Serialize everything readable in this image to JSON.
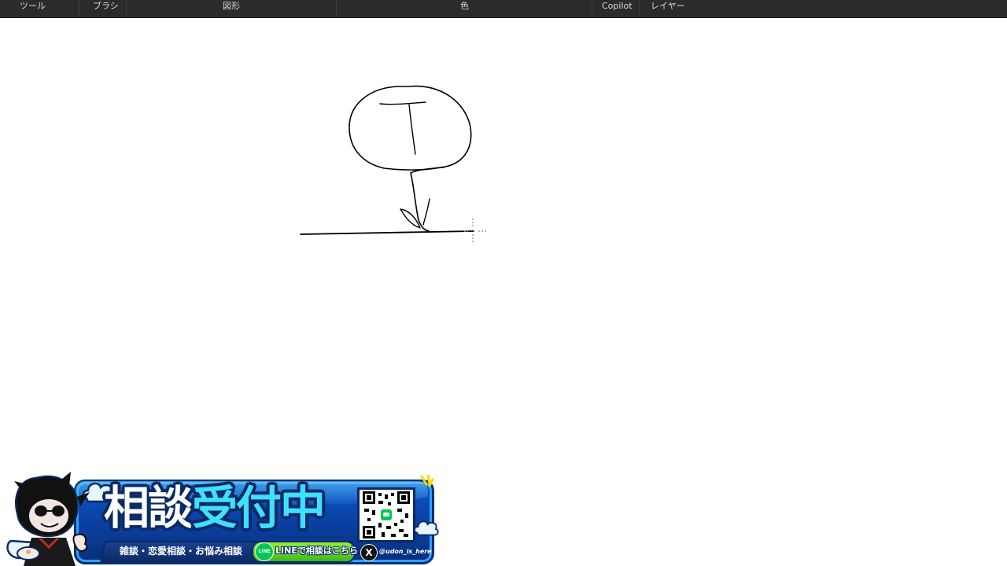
{
  "toolbar": {
    "sections": [
      {
        "id": "tools",
        "label": "ツール"
      },
      {
        "id": "brush",
        "label": "ブラシ"
      },
      {
        "id": "shapes",
        "label": "図形"
      },
      {
        "id": "color",
        "label": "色"
      },
      {
        "id": "copilot",
        "label": "Copilot"
      },
      {
        "id": "layers",
        "label": "レイヤー"
      }
    ]
  },
  "colors": {
    "toolbar_bg": "#2b2b2b",
    "toolbar_text": "#d8d8d8",
    "canvas_bg": "#ffffff",
    "ink": "#000000",
    "banner_blue": "#0a57c9",
    "banner_accent": "#3fe0ff",
    "line_green": "#06c755"
  },
  "canvas": {
    "drawing": "freehand sketch: flower with round head and stem on a ground line",
    "cursor_icon": "crosshair-cursor-icon"
  },
  "banner": {
    "title_part1": "相談",
    "title_part2": "受付中",
    "strip_text": "雑談・恋愛相談・お悩み相談",
    "line_label": "LINEで相談はこちら",
    "line_icon_text": "LINE",
    "x_icon_text": "X",
    "x_handle": "@udon_is_here"
  }
}
